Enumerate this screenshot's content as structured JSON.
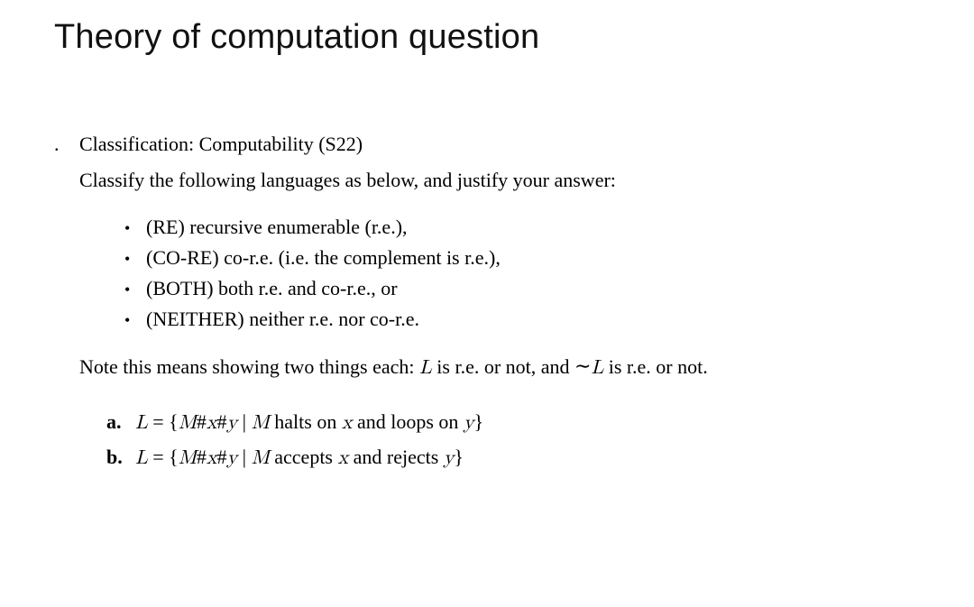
{
  "title": "Theory of computation question",
  "leading_dot": ".",
  "classification_line": "Classification: Computability (S22)",
  "instruction": "Classify the following languages as below, and justify your answer:",
  "bullets": [
    "(RE) recursive enumerable (r.e.),",
    "(CO-RE) co-r.e. (i.e. the complement is r.e.),",
    "(BOTH) both r.e. and co-r.e., or",
    "(NEITHER) neither r.e. nor co-r.e."
  ],
  "note_pre": "Note this means showing two things each: ",
  "note_L": "L",
  "note_mid1": " is r.e. or not, and ",
  "note_neg": "∼",
  "note_L2": "L",
  "note_mid2": " is r.e. or not.",
  "items": [
    {
      "label": "a.",
      "L": "L",
      "eq": " = {",
      "M": "M",
      "hash1": "#",
      "x1": "x",
      "hash2": "#",
      "y1": "y",
      "sep": " | ",
      "M2": "M",
      "text1": " halts on ",
      "x2": "x",
      "text2": " and loops on ",
      "y2": "y",
      "close": "}"
    },
    {
      "label": "b.",
      "L": "L",
      "eq": " = {",
      "M": "M",
      "hash1": "#",
      "x1": "x",
      "hash2": "#",
      "y1": "y",
      "sep": " | ",
      "M2": "M",
      "text1": " accepts ",
      "x2": "x",
      "text2": " and rejects ",
      "y2": "y",
      "close": "}"
    }
  ]
}
